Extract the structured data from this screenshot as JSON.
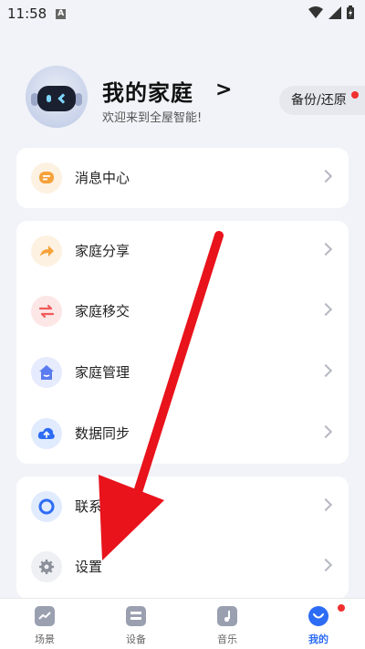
{
  "status_bar": {
    "time": "11:58",
    "notif_letter": "A"
  },
  "header": {
    "title": "我的家庭",
    "chevron": ">",
    "subtitle": "欢迎来到全屋智能!",
    "backup_label": "备份/还原"
  },
  "menu": {
    "group1": [
      {
        "label": "消息中心",
        "icon": "message-icon",
        "color": "#f6a13a"
      }
    ],
    "group2": [
      {
        "label": "家庭分享",
        "icon": "share-arrow-icon",
        "color": "#f6a13a"
      },
      {
        "label": "家庭移交",
        "icon": "transfer-icon",
        "color": "#f05a5a"
      },
      {
        "label": "家庭管理",
        "icon": "house-icon",
        "color": "#5b7cf0"
      },
      {
        "label": "数据同步",
        "icon": "cloud-upload-icon",
        "color": "#2d6cf4"
      }
    ],
    "group3": [
      {
        "label": "联系客服",
        "icon": "chat-icon",
        "color": "#2d6cf4"
      },
      {
        "label": "设置",
        "icon": "gear-icon",
        "color": "#8a8f99"
      }
    ]
  },
  "tabs": [
    {
      "label": "场景",
      "icon": "scene-icon",
      "active": false
    },
    {
      "label": "设备",
      "icon": "device-icon",
      "active": false
    },
    {
      "label": "音乐",
      "icon": "music-icon",
      "active": false
    },
    {
      "label": "我的",
      "icon": "profile-icon",
      "active": true
    }
  ],
  "colors": {
    "accent": "#2d6cf4",
    "badge": "#f0302f",
    "arrow": "#e8131b"
  }
}
